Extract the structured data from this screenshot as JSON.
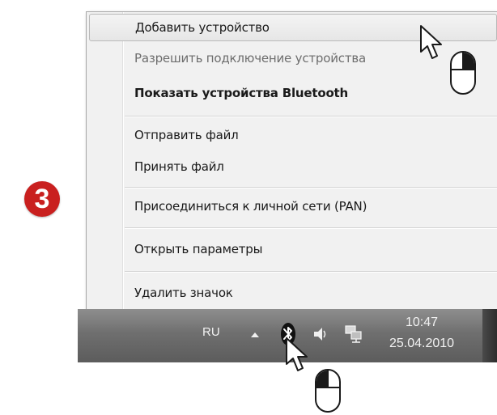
{
  "step": {
    "number": "3"
  },
  "context_menu": {
    "items": [
      {
        "label": "Добавить устройство",
        "state": "highlighted"
      },
      {
        "label": "Разрешить подключение устройства",
        "state": "disabled"
      },
      {
        "label": "Показать устройства Bluetooth",
        "state": "default-bold"
      },
      {
        "label": "Отправить файл",
        "state": "normal"
      },
      {
        "label": "Принять файл",
        "state": "normal"
      },
      {
        "label": "Присоединиться к личной сети (PAN)",
        "state": "normal"
      },
      {
        "label": "Открыть параметры",
        "state": "normal"
      },
      {
        "label": "Удалить значок",
        "state": "normal"
      }
    ]
  },
  "taskbar": {
    "language": "RU",
    "time": "10:47",
    "date": "25.04.2010",
    "icons": [
      "show-hidden-arrow-icon",
      "bluetooth-icon",
      "volume-icon",
      "network-icon"
    ]
  },
  "annotations": {
    "cursors": [
      "pointer-cursor",
      "pointer-cursor"
    ],
    "mouse_hints": [
      "mouse-left-click-icon",
      "mouse-right-click-icon"
    ]
  },
  "colors": {
    "badge": "#c9201f",
    "menu_background": "#f1f1f1",
    "taskbar_top": "#8e8e8e",
    "taskbar_bottom": "#5c5c5c"
  }
}
